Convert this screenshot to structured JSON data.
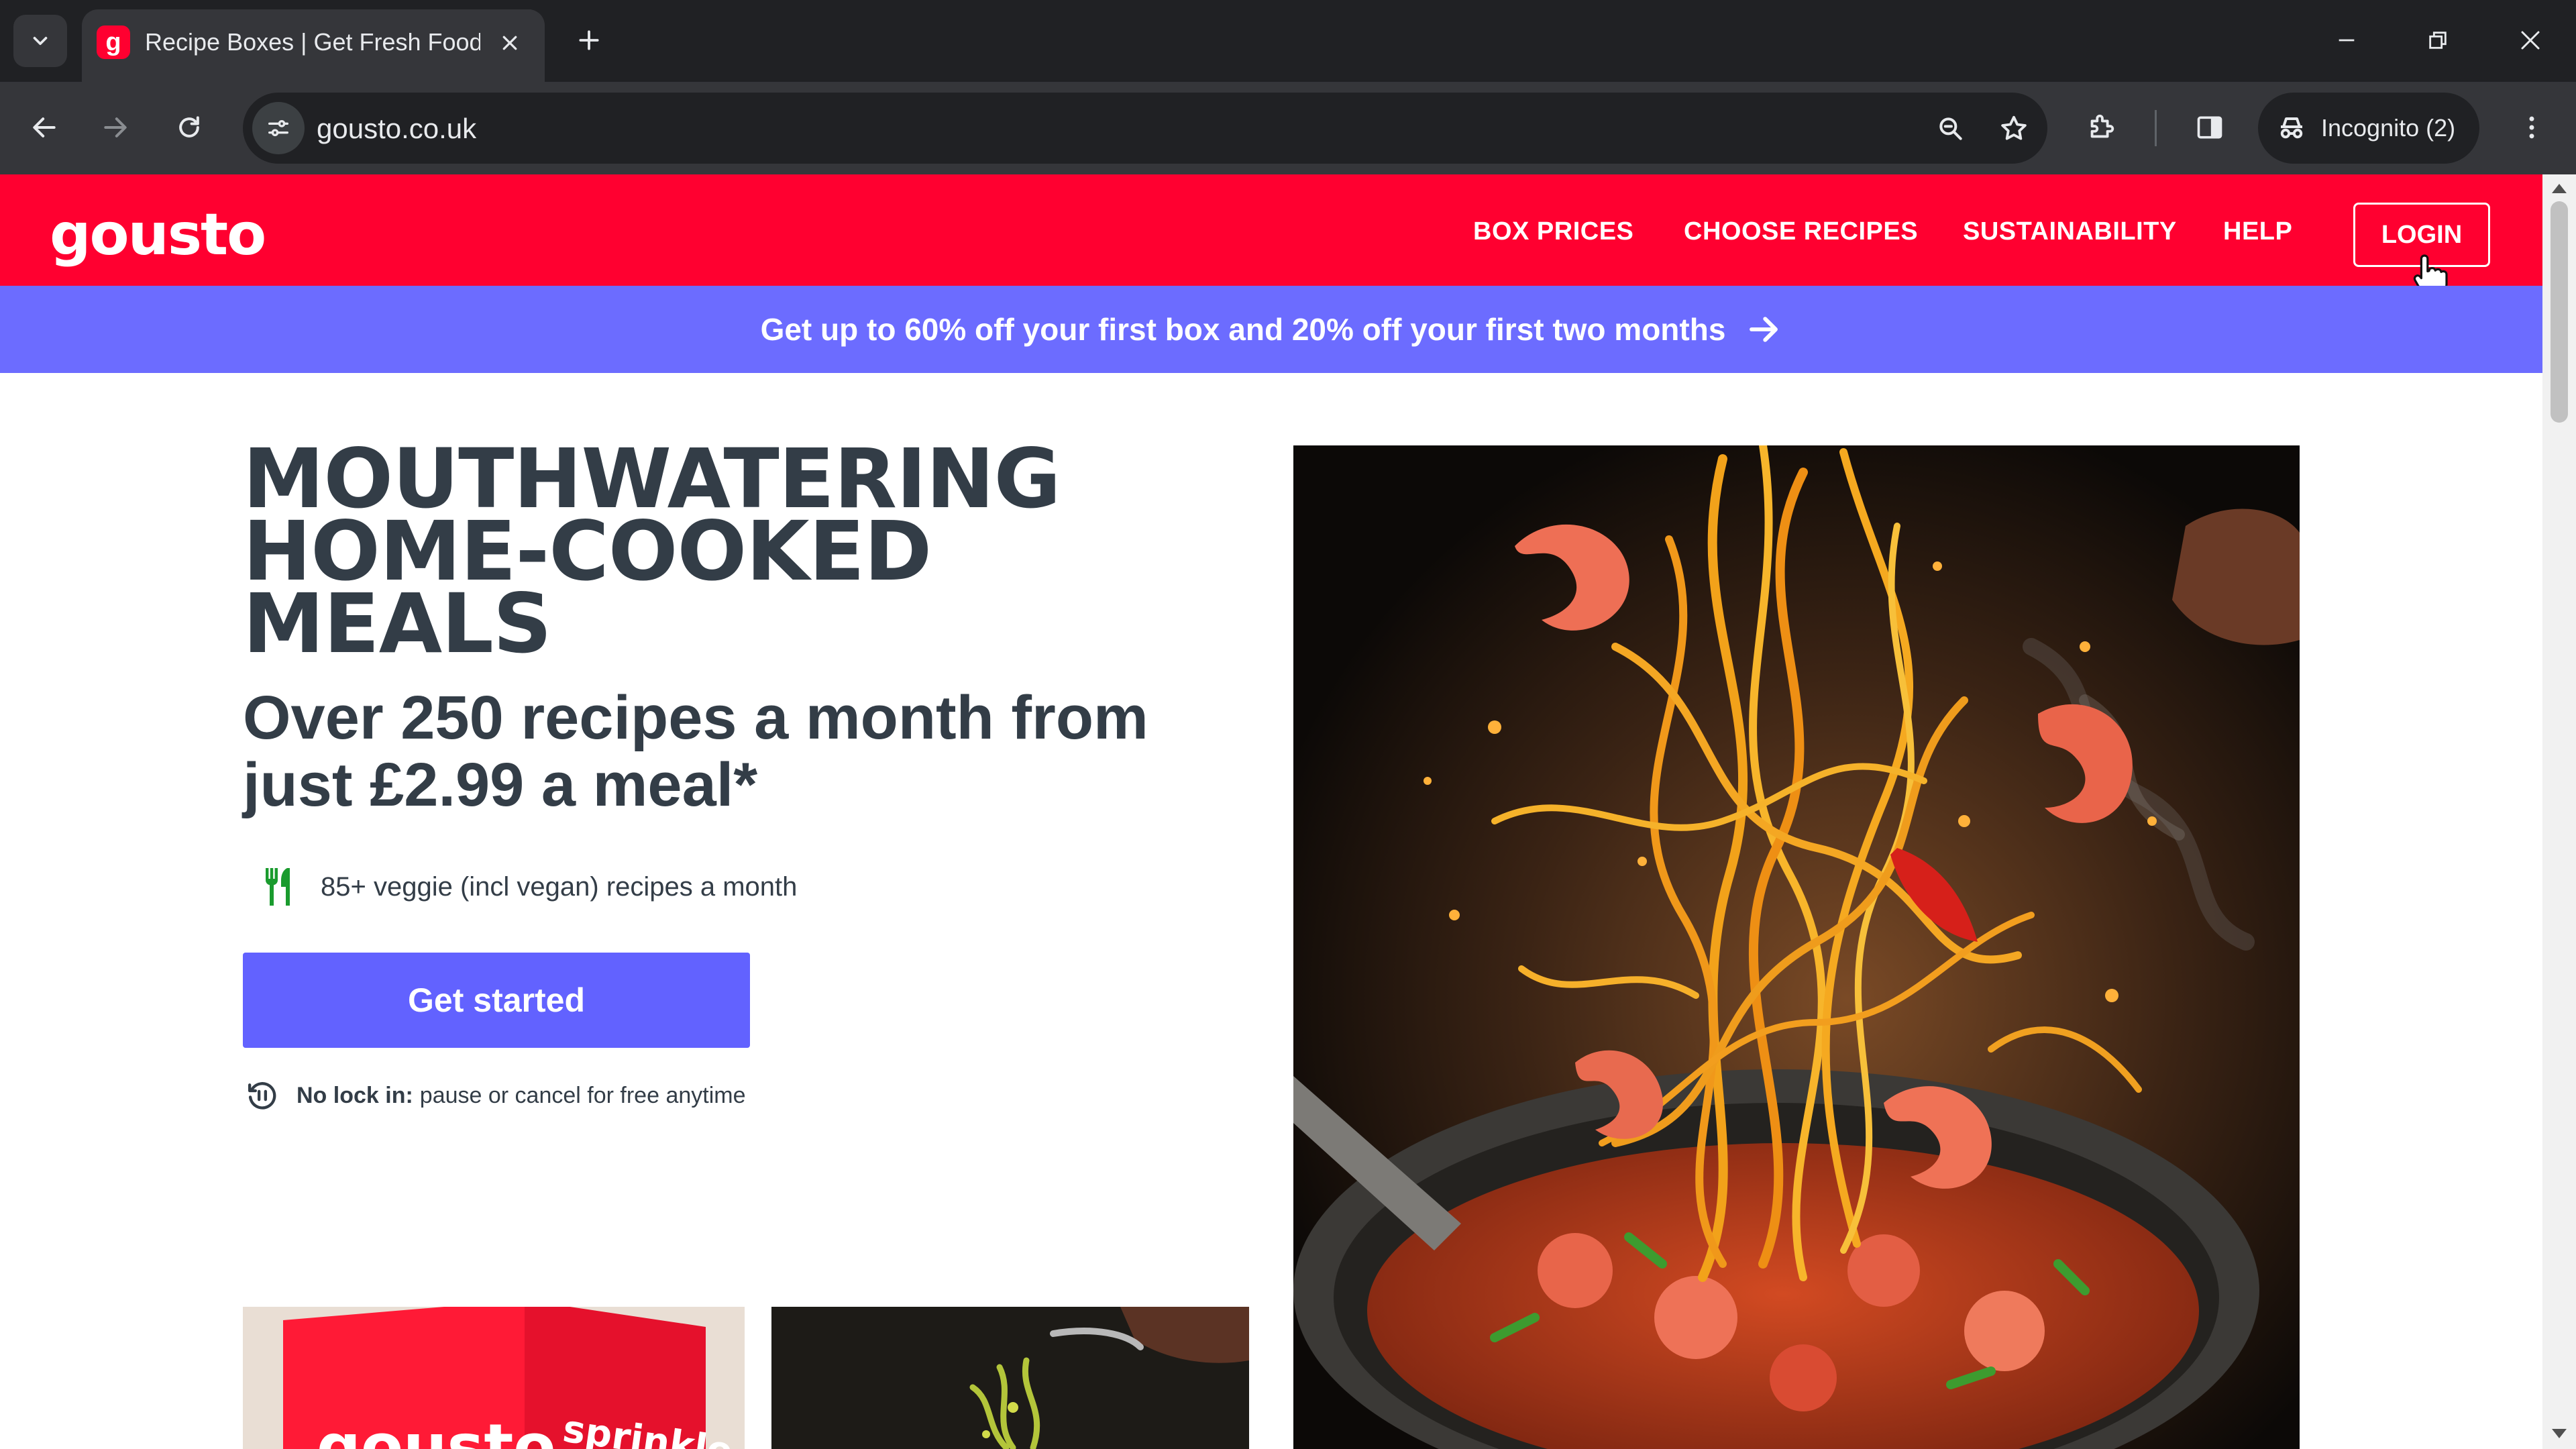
{
  "browser": {
    "tab_title": "Recipe Boxes | Get Fresh Food & Recipes Delivered",
    "url": "gousto.co.uk",
    "incognito_label": "Incognito (2)"
  },
  "site": {
    "logo": "gousto",
    "nav": [
      "BOX PRICES",
      "CHOOSE RECIPES",
      "SUSTAINABILITY",
      "HELP"
    ],
    "login_label": "LOGIN"
  },
  "promo": {
    "text": "Get up to 60% off your first box and 20% off your first two months"
  },
  "hero": {
    "title_lines": [
      "MOUTHWATERING",
      "HOME-COOKED",
      "MEALS"
    ],
    "subtitle": "Over 250 recipes a month from just £2.99 a meal*",
    "feature_text": "85+ veggie (incl vegan) recipes a month",
    "cta_label": "Get started",
    "lockin_bold": "No lock in:",
    "lockin_text": "pause or cancel for free anytime"
  },
  "thumbnails": {
    "box_brand": "gousto",
    "box_side": "sprinkle"
  },
  "colors": {
    "brand_red": "#ff0030",
    "promo_purple": "#6c6cff",
    "cta_purple": "#6262ff",
    "text_dark": "#333d47"
  }
}
